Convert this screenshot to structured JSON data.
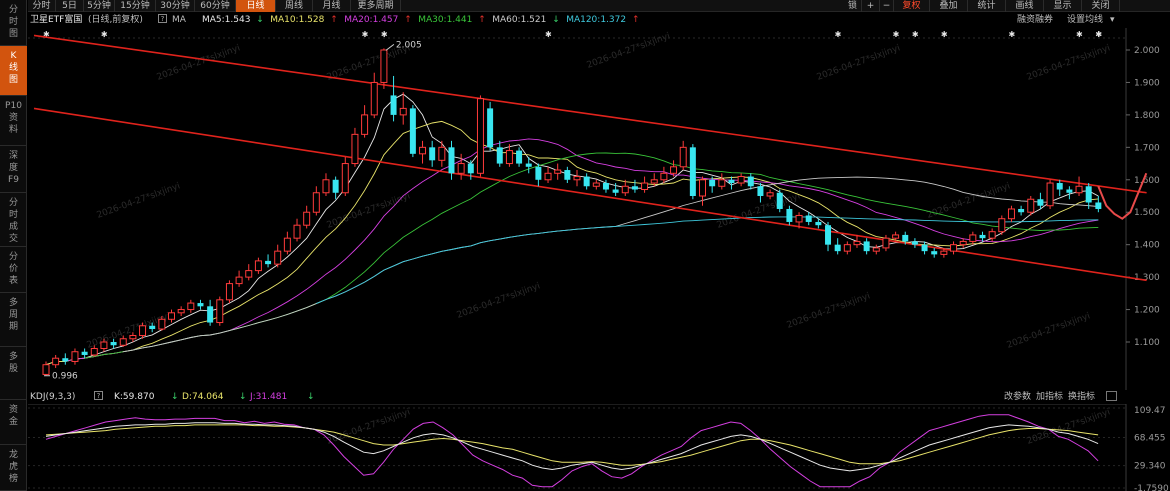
{
  "sidebar": {
    "tabs": [
      {
        "label": [
          "分",
          "时",
          "图"
        ],
        "active": false
      },
      {
        "label": [
          "K",
          "线",
          "图"
        ],
        "active": true
      },
      {
        "label": [
          "P10",
          "资",
          "料"
        ],
        "active": false
      },
      {
        "label": [
          "深",
          "度",
          "F9"
        ],
        "active": false
      },
      {
        "label": [
          "分",
          "时",
          "成",
          "交"
        ],
        "active": false
      },
      {
        "label": [
          "分",
          "价",
          "表"
        ],
        "active": false
      },
      {
        "label": [
          "多",
          "周",
          "期"
        ],
        "active": false
      },
      {
        "label": [
          "多",
          "股"
        ],
        "active": false
      },
      {
        "label": [
          "资",
          "金"
        ],
        "active": false
      },
      {
        "label": [
          "龙",
          "虎",
          "榜"
        ],
        "active": false
      }
    ]
  },
  "toolbar": {
    "periods": [
      "分时",
      "5日",
      "5分钟",
      "15分钟",
      "30分钟",
      "60分钟",
      "日线",
      "周线",
      "月线",
      "更多周期"
    ],
    "active_period": "日线",
    "right_items": {
      "lock": "锁",
      "plus": "+",
      "minus": "−",
      "restore": "复权",
      "overlay": "叠加",
      "statistics": "统计",
      "lines": "画线",
      "display": "显示",
      "close": "关闭"
    }
  },
  "info": {
    "title": "卫星ETF富国",
    "mode": "(日线,前复权)",
    "ma_label": "MA",
    "ma": [
      {
        "text": "MA5:1.543",
        "arrow": "↓",
        "color": "#e8e8e8",
        "arrow_color": "#3ad06a"
      },
      {
        "text": "MA10:1.528",
        "arrow": "↑",
        "color": "#e8e36a",
        "arrow_color": "#e0302a"
      },
      {
        "text": "MA20:1.457",
        "arrow": "↑",
        "color": "#d43fe0",
        "arrow_color": "#e0302a"
      },
      {
        "text": "MA30:1.441",
        "arrow": "↑",
        "color": "#39c439",
        "arrow_color": "#e0302a"
      },
      {
        "text": "MA60:1.521",
        "arrow": "↓",
        "color": "#c9c9c9",
        "arrow_color": "#3ad06a"
      },
      {
        "text": "MA120:1.372",
        "arrow": "↑",
        "color": "#3ec8dc",
        "arrow_color": "#e0302a"
      }
    ],
    "margin_trading": "融资融券",
    "ma_settings": "设置均线"
  },
  "price_axis": {
    "ticks": [
      "2.000",
      "1.900",
      "1.800",
      "1.700",
      "1.600",
      "1.500",
      "1.400",
      "1.300",
      "1.200",
      "1.100"
    ]
  },
  "annotations": {
    "high_label": "2.005",
    "low_label": "0.996"
  },
  "indicator": {
    "name": "KDJ(9,3,3)",
    "k": "K:59.870",
    "k_arrow": "↓",
    "d": "D:74.064",
    "d_arrow": "↓",
    "j": "J:31.481",
    "j_arrow": "↓",
    "buttons": [
      "改参数",
      "加指标",
      "换指标"
    ],
    "ticks": [
      "109.47",
      "68.455",
      "29.340",
      "-1.7590"
    ]
  },
  "watermark": "2026-04-27*slxjinyi",
  "chart_data": {
    "type": "candlestick",
    "price_range": [
      1.06,
      2.05
    ],
    "high": 2.005,
    "low": 0.996,
    "candles": [
      [
        1.0,
        1.03,
        0.996,
        1.04
      ],
      [
        1.03,
        1.05,
        1.02,
        1.06
      ],
      [
        1.05,
        1.04,
        1.03,
        1.065
      ],
      [
        1.04,
        1.07,
        1.03,
        1.08
      ],
      [
        1.07,
        1.06,
        1.05,
        1.08
      ],
      [
        1.06,
        1.08,
        1.055,
        1.09
      ],
      [
        1.08,
        1.1,
        1.07,
        1.11
      ],
      [
        1.1,
        1.09,
        1.08,
        1.11
      ],
      [
        1.09,
        1.11,
        1.085,
        1.12
      ],
      [
        1.11,
        1.12,
        1.1,
        1.13
      ],
      [
        1.12,
        1.15,
        1.11,
        1.16
      ],
      [
        1.15,
        1.14,
        1.13,
        1.16
      ],
      [
        1.14,
        1.17,
        1.135,
        1.18
      ],
      [
        1.17,
        1.19,
        1.16,
        1.2
      ],
      [
        1.19,
        1.2,
        1.18,
        1.21
      ],
      [
        1.2,
        1.22,
        1.19,
        1.23
      ],
      [
        1.22,
        1.21,
        1.2,
        1.23
      ],
      [
        1.21,
        1.16,
        1.15,
        1.23
      ],
      [
        1.16,
        1.23,
        1.15,
        1.24
      ],
      [
        1.23,
        1.28,
        1.22,
        1.29
      ],
      [
        1.28,
        1.3,
        1.27,
        1.32
      ],
      [
        1.3,
        1.32,
        1.29,
        1.34
      ],
      [
        1.32,
        1.35,
        1.31,
        1.36
      ],
      [
        1.35,
        1.34,
        1.33,
        1.37
      ],
      [
        1.34,
        1.38,
        1.33,
        1.4
      ],
      [
        1.38,
        1.42,
        1.37,
        1.44
      ],
      [
        1.42,
        1.46,
        1.41,
        1.48
      ],
      [
        1.46,
        1.5,
        1.45,
        1.52
      ],
      [
        1.5,
        1.56,
        1.49,
        1.58
      ],
      [
        1.56,
        1.6,
        1.55,
        1.62
      ],
      [
        1.6,
        1.56,
        1.54,
        1.61
      ],
      [
        1.56,
        1.65,
        1.55,
        1.67
      ],
      [
        1.65,
        1.74,
        1.64,
        1.76
      ],
      [
        1.74,
        1.8,
        1.73,
        1.83
      ],
      [
        1.8,
        1.9,
        1.79,
        1.93
      ],
      [
        1.9,
        2.0,
        1.88,
        2.005
      ],
      [
        1.86,
        1.8,
        1.78,
        1.92
      ],
      [
        1.8,
        1.82,
        1.77,
        1.87
      ],
      [
        1.82,
        1.68,
        1.67,
        1.83
      ],
      [
        1.68,
        1.7,
        1.65,
        1.72
      ],
      [
        1.7,
        1.66,
        1.64,
        1.72
      ],
      [
        1.66,
        1.7,
        1.64,
        1.72
      ],
      [
        1.7,
        1.62,
        1.6,
        1.72
      ],
      [
        1.62,
        1.65,
        1.6,
        1.68
      ],
      [
        1.65,
        1.62,
        1.6,
        1.66
      ],
      [
        1.62,
        1.85,
        1.61,
        1.86
      ],
      [
        1.82,
        1.7,
        1.69,
        1.84
      ],
      [
        1.7,
        1.65,
        1.64,
        1.72
      ],
      [
        1.65,
        1.69,
        1.64,
        1.71
      ],
      [
        1.69,
        1.65,
        1.64,
        1.7
      ],
      [
        1.65,
        1.64,
        1.62,
        1.67
      ],
      [
        1.64,
        1.6,
        1.58,
        1.65
      ],
      [
        1.6,
        1.62,
        1.59,
        1.64
      ],
      [
        1.62,
        1.63,
        1.6,
        1.65
      ],
      [
        1.63,
        1.6,
        1.59,
        1.64
      ],
      [
        1.6,
        1.61,
        1.58,
        1.63
      ],
      [
        1.61,
        1.58,
        1.57,
        1.62
      ],
      [
        1.58,
        1.59,
        1.57,
        1.6
      ],
      [
        1.59,
        1.57,
        1.56,
        1.6
      ],
      [
        1.57,
        1.56,
        1.55,
        1.59
      ],
      [
        1.56,
        1.58,
        1.55,
        1.6
      ],
      [
        1.58,
        1.57,
        1.56,
        1.6
      ],
      [
        1.57,
        1.59,
        1.56,
        1.61
      ],
      [
        1.59,
        1.6,
        1.58,
        1.62
      ],
      [
        1.6,
        1.62,
        1.59,
        1.64
      ],
      [
        1.62,
        1.64,
        1.61,
        1.66
      ],
      [
        1.64,
        1.7,
        1.63,
        1.72
      ],
      [
        1.7,
        1.55,
        1.54,
        1.71
      ],
      [
        1.55,
        1.6,
        1.52,
        1.61
      ],
      [
        1.6,
        1.58,
        1.56,
        1.61
      ],
      [
        1.58,
        1.6,
        1.57,
        1.62
      ],
      [
        1.6,
        1.59,
        1.57,
        1.61
      ],
      [
        1.59,
        1.61,
        1.58,
        1.62
      ],
      [
        1.61,
        1.58,
        1.57,
        1.62
      ],
      [
        1.58,
        1.55,
        1.53,
        1.59
      ],
      [
        1.55,
        1.56,
        1.54,
        1.57
      ],
      [
        1.56,
        1.51,
        1.5,
        1.57
      ],
      [
        1.51,
        1.47,
        1.46,
        1.52
      ],
      [
        1.47,
        1.49,
        1.45,
        1.5
      ],
      [
        1.49,
        1.47,
        1.46,
        1.5
      ],
      [
        1.47,
        1.46,
        1.45,
        1.48
      ],
      [
        1.46,
        1.4,
        1.38,
        1.47
      ],
      [
        1.4,
        1.38,
        1.37,
        1.42
      ],
      [
        1.38,
        1.4,
        1.37,
        1.41
      ],
      [
        1.4,
        1.41,
        1.39,
        1.43
      ],
      [
        1.41,
        1.38,
        1.37,
        1.42
      ],
      [
        1.38,
        1.39,
        1.37,
        1.4
      ],
      [
        1.39,
        1.42,
        1.38,
        1.43
      ],
      [
        1.42,
        1.43,
        1.41,
        1.44
      ],
      [
        1.43,
        1.41,
        1.4,
        1.44
      ],
      [
        1.41,
        1.4,
        1.39,
        1.42
      ],
      [
        1.4,
        1.38,
        1.37,
        1.41
      ],
      [
        1.38,
        1.37,
        1.36,
        1.39
      ],
      [
        1.37,
        1.38,
        1.36,
        1.39
      ],
      [
        1.38,
        1.4,
        1.37,
        1.41
      ],
      [
        1.4,
        1.41,
        1.39,
        1.42
      ],
      [
        1.41,
        1.43,
        1.4,
        1.44
      ],
      [
        1.43,
        1.42,
        1.41,
        1.44
      ],
      [
        1.42,
        1.44,
        1.41,
        1.45
      ],
      [
        1.44,
        1.48,
        1.43,
        1.49
      ],
      [
        1.48,
        1.51,
        1.47,
        1.52
      ],
      [
        1.51,
        1.5,
        1.49,
        1.52
      ],
      [
        1.5,
        1.54,
        1.49,
        1.55
      ],
      [
        1.54,
        1.52,
        1.51,
        1.56
      ],
      [
        1.52,
        1.59,
        1.51,
        1.6
      ],
      [
        1.59,
        1.57,
        1.55,
        1.6
      ],
      [
        1.57,
        1.56,
        1.54,
        1.58
      ],
      [
        1.56,
        1.58,
        1.55,
        1.61
      ],
      [
        1.58,
        1.53,
        1.51,
        1.59
      ],
      [
        1.53,
        1.51,
        1.5,
        1.55
      ]
    ],
    "ma_lines": [
      {
        "name": "MA5",
        "color": "#e8e8e8"
      },
      {
        "name": "MA10",
        "color": "#e8e36a"
      },
      {
        "name": "MA20",
        "color": "#d43fe0"
      },
      {
        "name": "MA30",
        "color": "#39c439"
      },
      {
        "name": "MA60",
        "color": "#c9c9c9"
      },
      {
        "name": "MA120",
        "color": "#3ec8dc"
      }
    ],
    "channel_lines": [
      {
        "from": [
          0,
          2.045
        ],
        "to": [
          114,
          1.56
        ]
      },
      {
        "from": [
          0,
          1.82
        ],
        "to": [
          114,
          1.29
        ]
      }
    ],
    "projection": [
      1.58,
      1.52,
      1.495,
      1.48,
      1.5,
      1.56,
      1.62
    ],
    "kdj": {
      "range": [
        -1.759,
        109.47
      ],
      "k": [
        70,
        72,
        74,
        76,
        78,
        80,
        82,
        84,
        85,
        86,
        86,
        87,
        87,
        88,
        88,
        89,
        89,
        89,
        88,
        88,
        87,
        87,
        86,
        86,
        85,
        84,
        82,
        80,
        76,
        70,
        62,
        55,
        48,
        46,
        50,
        56,
        62,
        68,
        72,
        74,
        72,
        68,
        62,
        56,
        52,
        48,
        44,
        40,
        36,
        30,
        26,
        24,
        26,
        30,
        32,
        34,
        30,
        26,
        24,
        26,
        30,
        34,
        38,
        42,
        46,
        52,
        58,
        62,
        66,
        70,
        72,
        70,
        66,
        60,
        54,
        48,
        42,
        36,
        30,
        26,
        24,
        22,
        24,
        26,
        30,
        34,
        40,
        46,
        52,
        58,
        62,
        66,
        70,
        74,
        78,
        82,
        84,
        86,
        85,
        84,
        82,
        80,
        76,
        74,
        70,
        66,
        60
      ],
      "d": [
        72,
        73,
        74,
        75,
        76,
        77,
        78,
        80,
        81,
        82,
        83,
        84,
        84,
        85,
        85,
        86,
        86,
        86,
        86,
        86,
        86,
        85,
        85,
        84,
        84,
        83,
        82,
        80,
        78,
        76,
        72,
        68,
        64,
        60,
        58,
        58,
        60,
        62,
        64,
        66,
        67,
        66,
        64,
        62,
        60,
        57,
        54,
        52,
        48,
        44,
        40,
        36,
        34,
        34,
        34,
        35,
        34,
        32,
        30,
        30,
        31,
        33,
        35,
        38,
        41,
        44,
        48,
        52,
        56,
        60,
        64,
        66,
        66,
        64,
        61,
        58,
        54,
        50,
        46,
        42,
        38,
        34,
        32,
        32,
        32,
        34,
        36,
        40,
        44,
        48,
        52,
        56,
        60,
        64,
        68,
        72,
        75,
        78,
        80,
        81,
        81,
        80,
        79,
        78,
        76,
        74,
        72
      ],
      "j": [
        66,
        70,
        74,
        78,
        82,
        86,
        90,
        92,
        94,
        96,
        94,
        93,
        93,
        94,
        94,
        95,
        95,
        95,
        92,
        92,
        89,
        91,
        88,
        90,
        87,
        86,
        82,
        80,
        72,
        58,
        42,
        29,
        16,
        18,
        34,
        52,
        66,
        80,
        88,
        90,
        82,
        72,
        58,
        44,
        36,
        30,
        24,
        16,
        12,
        2,
        0,
        0,
        10,
        22,
        28,
        32,
        22,
        14,
        12,
        18,
        28,
        36,
        44,
        50,
        56,
        68,
        78,
        82,
        86,
        90,
        88,
        78,
        66,
        52,
        40,
        28,
        18,
        8,
        0,
        0,
        0,
        0,
        8,
        14,
        26,
        34,
        48,
        58,
        68,
        78,
        82,
        86,
        90,
        94,
        98,
        100,
        100,
        100,
        95,
        90,
        84,
        80,
        70,
        66,
        58,
        50,
        36
      ]
    }
  }
}
